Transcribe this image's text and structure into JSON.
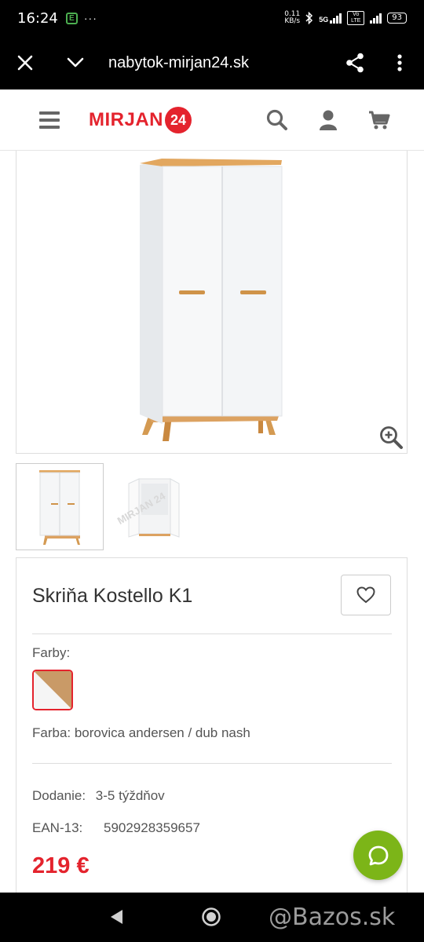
{
  "status_bar": {
    "time": "16:24",
    "app_icon": "E",
    "dots": "···",
    "net_speed_value": "0.11",
    "net_speed_unit": "KB/s",
    "network": "5G",
    "volte": "Vo LTE",
    "battery": "93"
  },
  "browser": {
    "url": "nabytok-mirjan24.sk",
    "icons": [
      "close-icon",
      "chevron-down-icon",
      "share-icon",
      "more-vert-icon"
    ]
  },
  "site_header": {
    "logo_text": "MIRJAN",
    "logo_badge": "24",
    "brand_color": "#e4232d",
    "icons": [
      "menu-icon",
      "search-icon",
      "user-icon",
      "cart-icon"
    ]
  },
  "gallery": {
    "thumbnail_watermark": "MIRJAN 24"
  },
  "product": {
    "title": "Skriňa Kostello K1",
    "colors_label": "Farby:",
    "color_text": "Farba: borovica andersen / dub nash",
    "delivery_label": "Dodanie:",
    "delivery_value": "3-5 týždňov",
    "ean_label": "EAN-13:",
    "ean_value": "5902928359657",
    "price": "219 €"
  },
  "chat": {
    "accent": "#7cb518"
  },
  "nav": {
    "watermark": "@Bazos.sk"
  }
}
